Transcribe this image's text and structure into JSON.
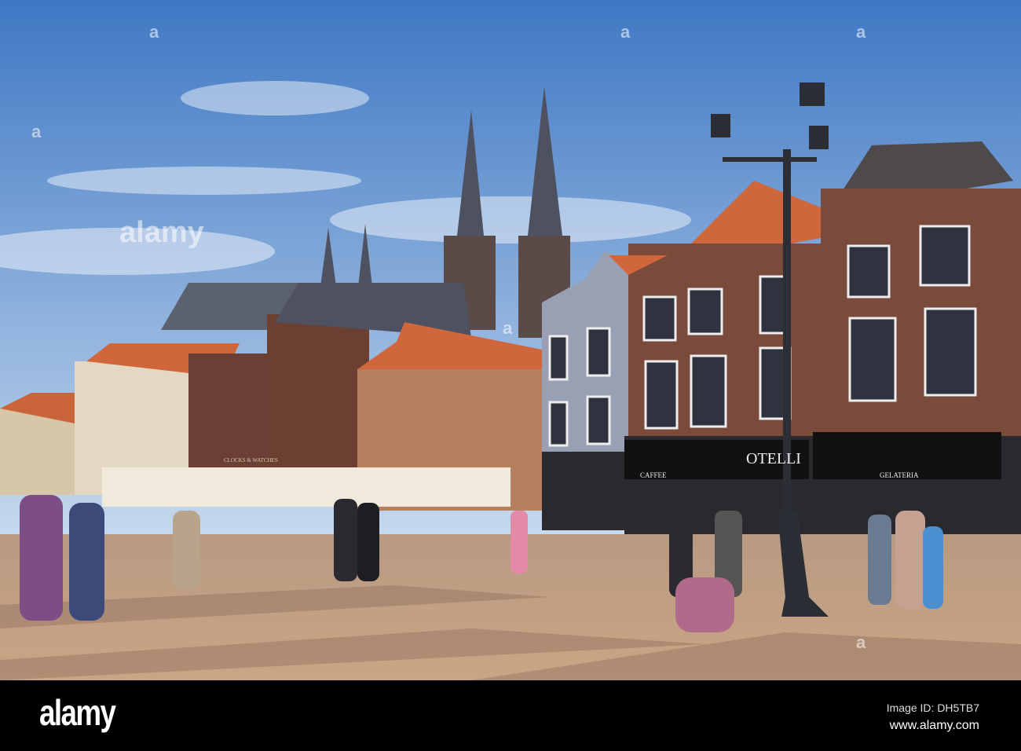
{
  "photo": {
    "shop_signs": {
      "otelli": "OTELLI",
      "caffee": "CAFFEE",
      "gelateria": "GELATERIA",
      "clocks": "CLOCKS & WATCHES"
    }
  },
  "watermark": {
    "mark": "a",
    "logo": "alamy"
  },
  "footer": {
    "logo": "alamy",
    "image_id": "Image ID: DH5TB7",
    "url": "www.alamy.com"
  },
  "colors": {
    "sky_top": "#3f78c4",
    "sky_bottom": "#c5d8ee",
    "pavement": "#c9a98a",
    "brick": "#7a4a3a",
    "roof_tile": "#d0673c"
  }
}
